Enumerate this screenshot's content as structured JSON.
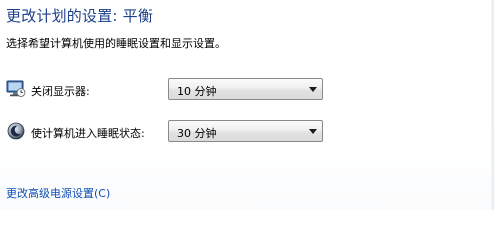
{
  "header": {
    "title": "更改计划的设置: 平衡",
    "subtitle": "选择希望计算机使用的睡眠设置和显示设置。"
  },
  "settings": [
    {
      "icon": "monitor-icon",
      "label": "关闭显示器:",
      "value": "10 分钟"
    },
    {
      "icon": "sleep-moon-icon",
      "label": "使计算机进入睡眠状态:",
      "value": "30 分钟"
    }
  ],
  "footer": {
    "advanced_link": "更改高级电源设置(C)"
  },
  "colors": {
    "title": "#1e3f8a",
    "link": "#0d4fb3"
  }
}
